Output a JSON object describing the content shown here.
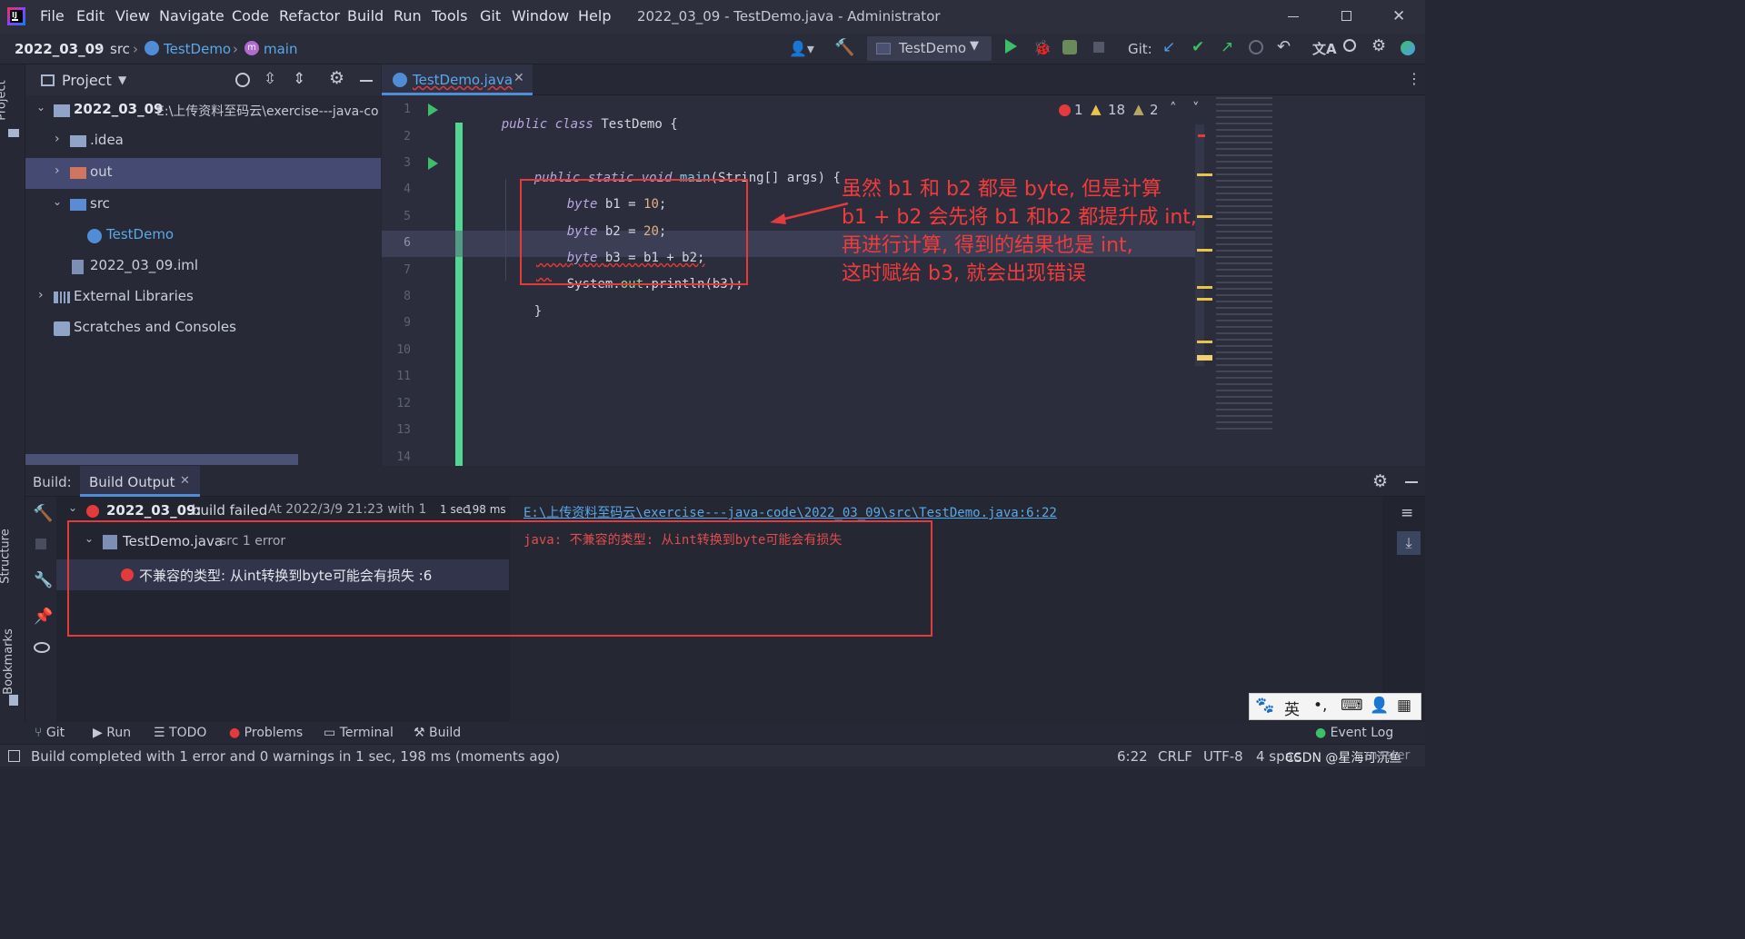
{
  "window": {
    "title": "2022_03_09 - TestDemo.java - Administrator",
    "menu": [
      "File",
      "Edit",
      "View",
      "Navigate",
      "Code",
      "Refactor",
      "Build",
      "Run",
      "Tools",
      "Git",
      "Window",
      "Help"
    ]
  },
  "nav": {
    "project": "2022_03_09",
    "src": "src",
    "class": "TestDemo",
    "method": "main",
    "run_config": "TestDemo",
    "git_label": "Git:"
  },
  "project_panel": {
    "title": "Project",
    "root_name": "2022_03_09",
    "root_path": "E:\\上传资料至码云\\exercise---java-co",
    "items": [
      ".idea",
      "out",
      "src",
      "TestDemo",
      "2022_03_09.iml",
      "External Libraries",
      "Scratches and Consoles"
    ]
  },
  "sidebar_labels": {
    "project": "Project",
    "structure": "Structure",
    "bookmarks": "Bookmarks"
  },
  "editor": {
    "tab": "TestDemo.java",
    "inspection": {
      "errors": "1",
      "warnings": "18",
      "weak": "2"
    },
    "line_numbers": [
      "1",
      "2",
      "3",
      "4",
      "5",
      "6",
      "7",
      "8",
      "9",
      "10",
      "11",
      "12",
      "13",
      "14"
    ],
    "lines": {
      "l1": {
        "kw": "public class",
        "name": "TestDemo",
        "rest": "{"
      },
      "l3": {
        "kw": "public static void",
        "name": "main",
        "rest": "(String[] args) {"
      },
      "l4": {
        "type": "byte",
        "name": "b1 = ",
        "num": "10",
        ";": ";"
      },
      "l5": {
        "type": "byte",
        "name": "b2 = ",
        "num": "20"
      },
      "l6": {
        "type": "byte",
        "text": "b3 = b1 + b2;"
      },
      "l7": {
        "a": "System.",
        "field": "out",
        "b": ".println(b3);"
      },
      "l8": "}"
    },
    "annotation": [
      "虽然 b1 和 b2 都是 byte, 但是计算",
      "b1 + b2 会先将 b1 和b2 都提升成 int,",
      "再进行计算, 得到的结果也是 int,",
      "这时赋给 b3, 就会出现错误"
    ]
  },
  "build": {
    "label": "Build:",
    "tab": "Build Output",
    "root_name": "2022_03_09:",
    "root_status": "build failed",
    "root_time": "At 2022/3/9 21:23 with 1",
    "root_dur1": "1 sec,",
    "root_dur2": "198 ms",
    "file": "TestDemo.java",
    "file_meta": "src 1 error",
    "error_item": "不兼容的类型: 从int转换到byte可能会有损失 :6",
    "link": "E:\\上传资料至码云\\exercise---java-code\\2022_03_09\\src\\TestDemo.java:6:22",
    "message": "java: 不兼容的类型: 从int转换到byte可能会有损失"
  },
  "bottom_tools": [
    "Git",
    "Run",
    "TODO",
    "Problems",
    "Terminal",
    "Build"
  ],
  "event_log": "Event Log",
  "ime": [
    "英"
  ],
  "status": {
    "message": "Build completed with 1 error and 0 warnings in 1 sec, 198 ms (moments ago)",
    "position": "6:22",
    "line_sep": "CRLF",
    "encoding": "UTF-8",
    "indent": "4 spaces",
    "watermark": "CSDN @星海可沉鱼",
    "branch": "master"
  },
  "colors": {
    "accent": "#4f8dd6",
    "error": "#e33b3b",
    "annotation": "#f23b3b",
    "link": "#59a8e8"
  }
}
